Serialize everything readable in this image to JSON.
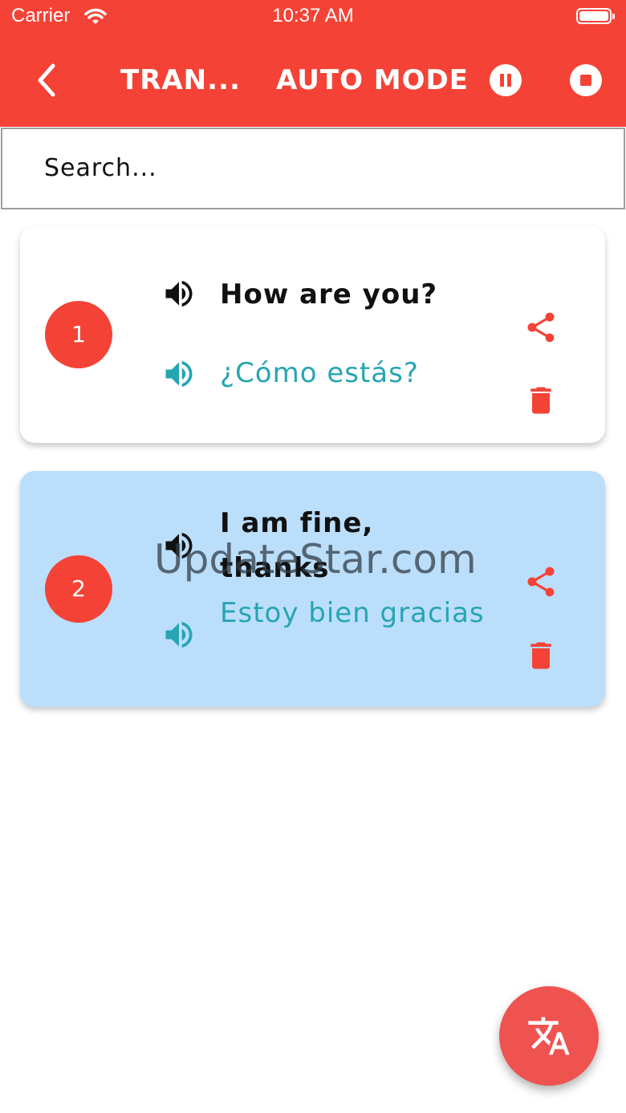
{
  "status_bar": {
    "carrier": "Carrier",
    "time": "10:37 AM"
  },
  "app_bar": {
    "title": "TRAN...",
    "mode": "AUTO MODE",
    "accent_color": "#f44336"
  },
  "search": {
    "placeholder": "Search..."
  },
  "translations": [
    {
      "number": "1",
      "source": "How are you?",
      "target": "¿Cómo estás?",
      "background": "#ffffff"
    },
    {
      "number": "2",
      "source": "I am fine, thanks",
      "target": "Estoy bien gracias",
      "background": "#bbdefb",
      "selected": true
    }
  ],
  "watermark": "UpdateStar.com",
  "icons": {
    "back": "chevron-left-icon",
    "pause": "pause-circle-icon",
    "stop": "stop-circle-icon",
    "speaker": "volume-up-icon",
    "share": "share-icon",
    "delete": "trash-icon",
    "fab": "translate-icon"
  },
  "colors": {
    "source_text": "#111111",
    "target_text": "#26a5b3",
    "number_badge": "#f44336"
  }
}
